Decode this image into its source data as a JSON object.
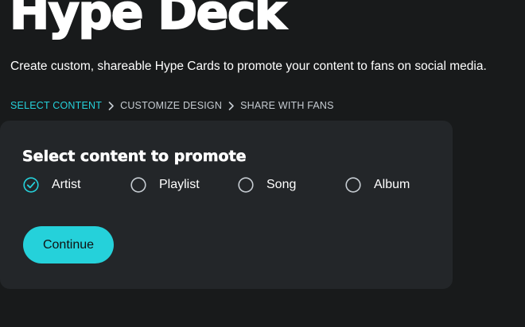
{
  "header": {
    "title": "Hype Deck",
    "subtitle": "Create custom, shareable Hype Cards to promote your content to fans on social media."
  },
  "breadcrumb": {
    "steps": [
      {
        "label": "SELECT CONTENT",
        "active": true
      },
      {
        "label": "CUSTOMIZE DESIGN",
        "active": false
      },
      {
        "label": "SHARE WITH FANS",
        "active": false
      }
    ],
    "separator_icon": "chevron-right-icon"
  },
  "content_card": {
    "heading": "Select content to promote",
    "options": [
      {
        "label": "Artist",
        "selected": true,
        "icon": "check-circle-icon"
      },
      {
        "label": "Playlist",
        "selected": false,
        "icon": "radio-circle-icon"
      },
      {
        "label": "Song",
        "selected": false,
        "icon": "radio-circle-icon"
      },
      {
        "label": "Album",
        "selected": false,
        "icon": "radio-circle-icon"
      }
    ],
    "continue_label": "Continue"
  },
  "colors": {
    "background": "#181a1b",
    "card": "#232629",
    "accent": "#25d1da",
    "muted_text": "#c6ccd2"
  }
}
